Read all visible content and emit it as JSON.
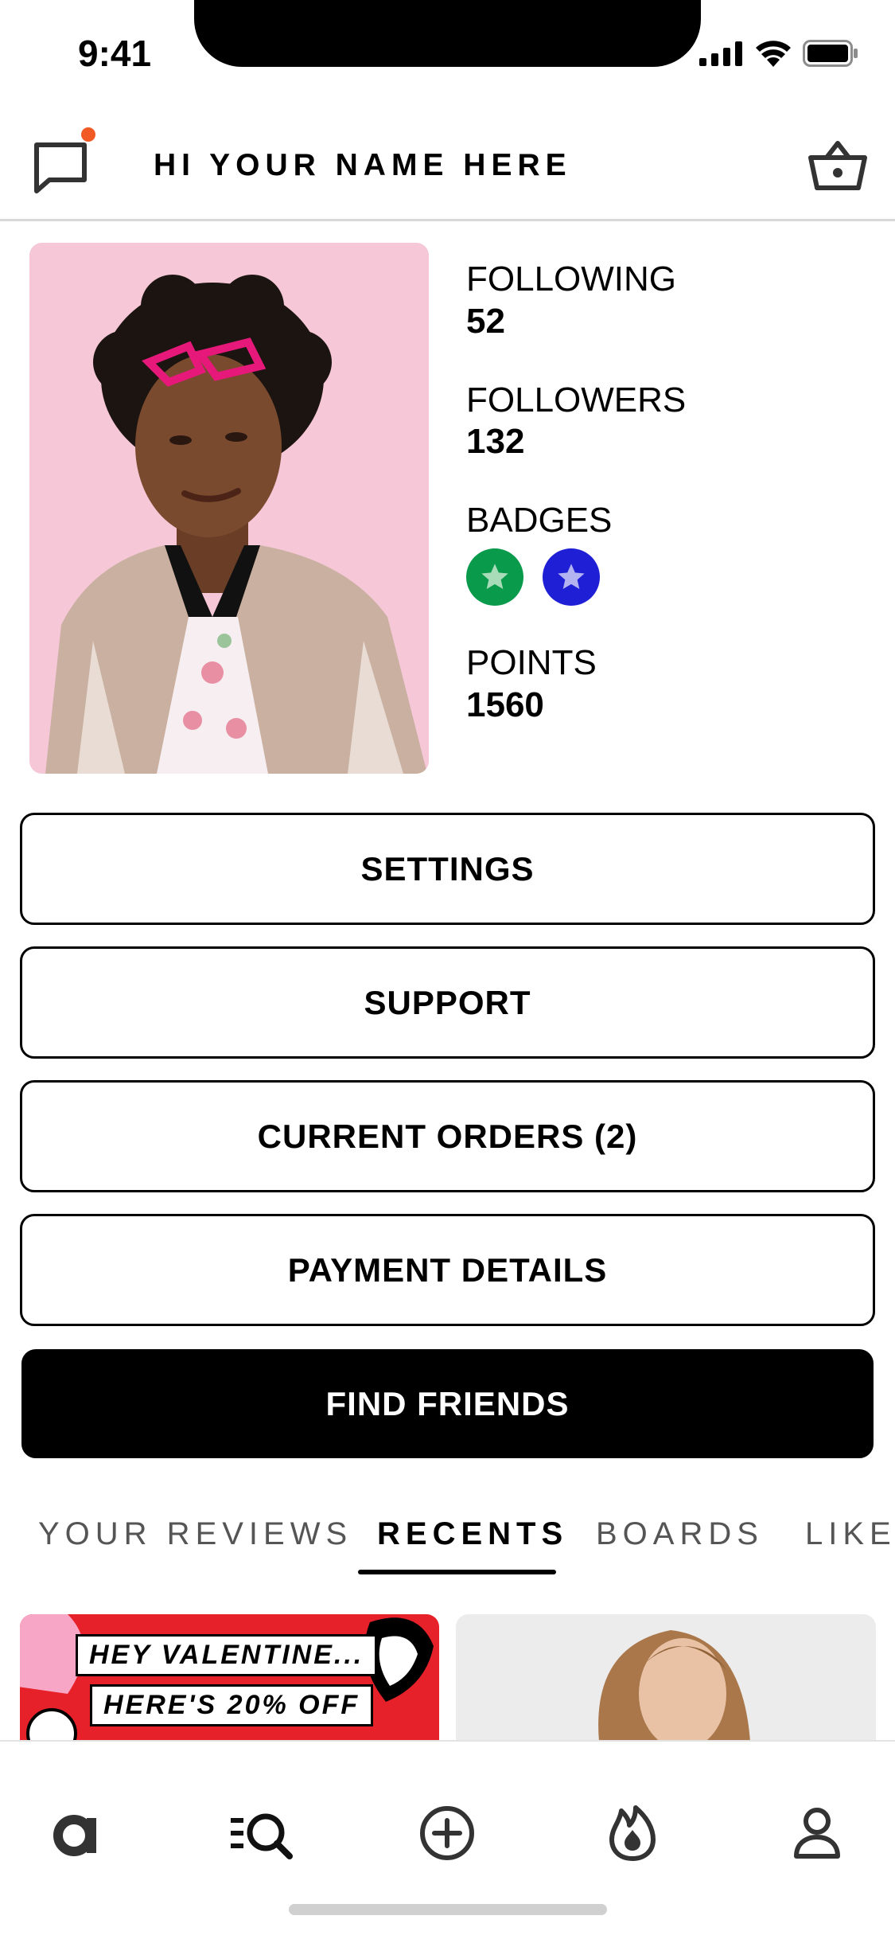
{
  "status_bar": {
    "time": "9:41"
  },
  "header": {
    "greeting": "HI YOUR NAME HERE"
  },
  "profile": {
    "following_label": "FOLLOWING",
    "following_value": "52",
    "followers_label": "FOLLOWERS",
    "followers_value": "132",
    "badges_label": "BADGES",
    "badges": [
      {
        "icon": "star-icon",
        "color": "#0a9a4c"
      },
      {
        "icon": "star-icon",
        "color": "#1f1fd6"
      }
    ],
    "points_label": "POINTS",
    "points_value": "1560"
  },
  "actions": {
    "settings": "SETTINGS",
    "support": "SUPPORT",
    "current_orders": "CURRENT ORDERS (2)",
    "payment_details": "PAYMENT DETAILS",
    "find_friends": "FIND FRIENDS"
  },
  "tabs": [
    {
      "label": "YOUR REVIEWS",
      "active": false
    },
    {
      "label": "RECENTS",
      "active": true
    },
    {
      "label": "BOARDS",
      "active": false
    },
    {
      "label": "LIKED",
      "active": false
    }
  ],
  "cards": {
    "promo_line1": "HEY VALENTINE...",
    "promo_line2": "HERE'S 20% OFF"
  },
  "bottom_nav": [
    {
      "icon": "home-a-icon"
    },
    {
      "icon": "search-icon"
    },
    {
      "icon": "add-icon"
    },
    {
      "icon": "fire-icon"
    },
    {
      "icon": "profile-icon"
    }
  ],
  "colors": {
    "notification_dot": "#f15a24",
    "accent_black": "#000000",
    "promo_red": "#e6212a",
    "photo_background": "#f4c6d6"
  }
}
